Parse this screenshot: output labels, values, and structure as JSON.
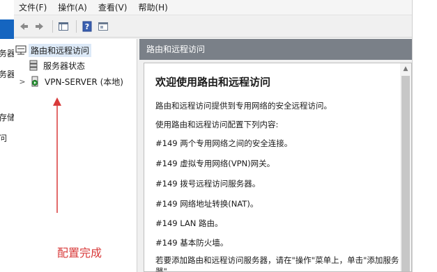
{
  "background_window": {
    "fragments": [
      "务器",
      "务器",
      "存储",
      "问"
    ]
  },
  "menubar": {
    "items": [
      "文件(F)",
      "操作(A)",
      "查看(V)",
      "帮助(H)"
    ]
  },
  "toolbar": {
    "buttons": [
      "back-icon",
      "forward-icon",
      "show-hide-tree-icon",
      "help-icon",
      "properties-icon"
    ]
  },
  "tree": {
    "root_label": "路由和远程访问",
    "items": [
      {
        "label": "服务器状态"
      },
      {
        "label": "VPN-SERVER (本地)",
        "expander": ">"
      }
    ]
  },
  "annotation": {
    "text": "配置完成",
    "color": "#d83a3a"
  },
  "right_pane": {
    "header": "路由和远程访问",
    "title": "欢迎使用路由和远程访问",
    "lines": [
      "路由和远程访问提供到专用网络的安全远程访问。",
      "使用路由和远程访问配置下列内容:",
      "#149 两个专用网络之间的安全连接。",
      "#149 虚拟专用网络(VPN)网关。",
      "#149 拨号远程访问服务器。",
      "#149 网络地址转换(NAT)。",
      "#149 LAN 路由。",
      "#149 基本防火墙。",
      "若要添加路由和远程访问服务器，请在\"操作\"菜单上，单击\"添加服务",
      "器\"。"
    ]
  },
  "colors": {
    "header_bg": "#7a8088",
    "selection": "#dce9f7",
    "arrow": "#d83a3a"
  }
}
